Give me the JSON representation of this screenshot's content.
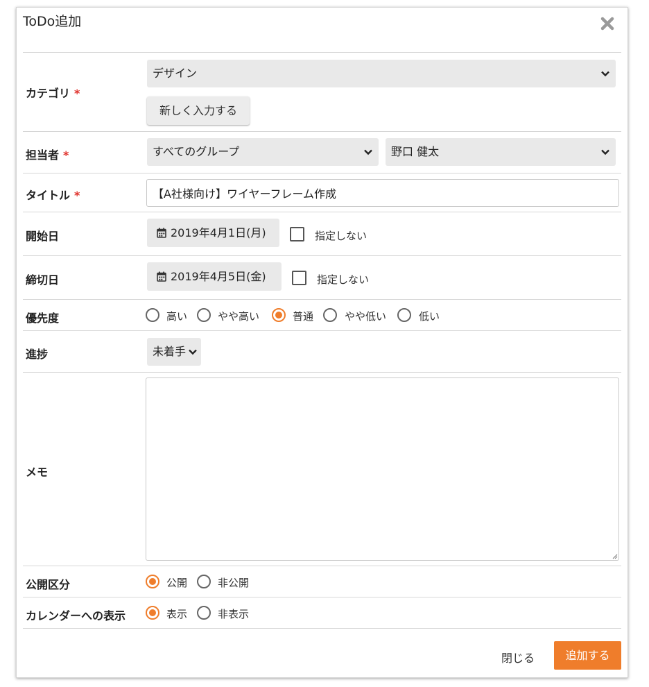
{
  "dialog": {
    "title": "ToDo追加",
    "close_icon": "close-icon"
  },
  "category": {
    "label": "カテゴリ",
    "required_mark": "*",
    "selected": "デザイン",
    "new_input_button": "新しく入力する"
  },
  "assignee": {
    "label": "担当者",
    "required_mark": "*",
    "group_selected": "すべてのグループ",
    "person_selected": "野口 健太"
  },
  "title_field": {
    "label": "タイトル",
    "required_mark": "*",
    "value": "【A社様向け】ワイヤーフレーム作成"
  },
  "start_date": {
    "label": "開始日",
    "value": "2019年4月1日(月)",
    "unspecified_label": "指定しない"
  },
  "due_date": {
    "label": "締切日",
    "value": "2019年4月5日(金)",
    "unspecified_label": "指定しない"
  },
  "priority": {
    "label": "優先度",
    "options": [
      "高い",
      "やや高い",
      "普通",
      "やや低い",
      "低い"
    ],
    "selected": "普通"
  },
  "progress": {
    "label": "進捗",
    "selected": "未着手"
  },
  "memo": {
    "label": "メモ",
    "value": ""
  },
  "visibility": {
    "label": "公開区分",
    "options": [
      "公開",
      "非公開"
    ],
    "selected": "公開"
  },
  "calendar_display": {
    "label": "カレンダーへの表示",
    "options": [
      "表示",
      "非表示"
    ],
    "selected": "表示"
  },
  "footer": {
    "close_button": "閉じる",
    "add_button": "追加する"
  },
  "colors": {
    "accent": "#ef7d2b",
    "required": "#e0332d",
    "select_bg": "#e9e9e9"
  }
}
